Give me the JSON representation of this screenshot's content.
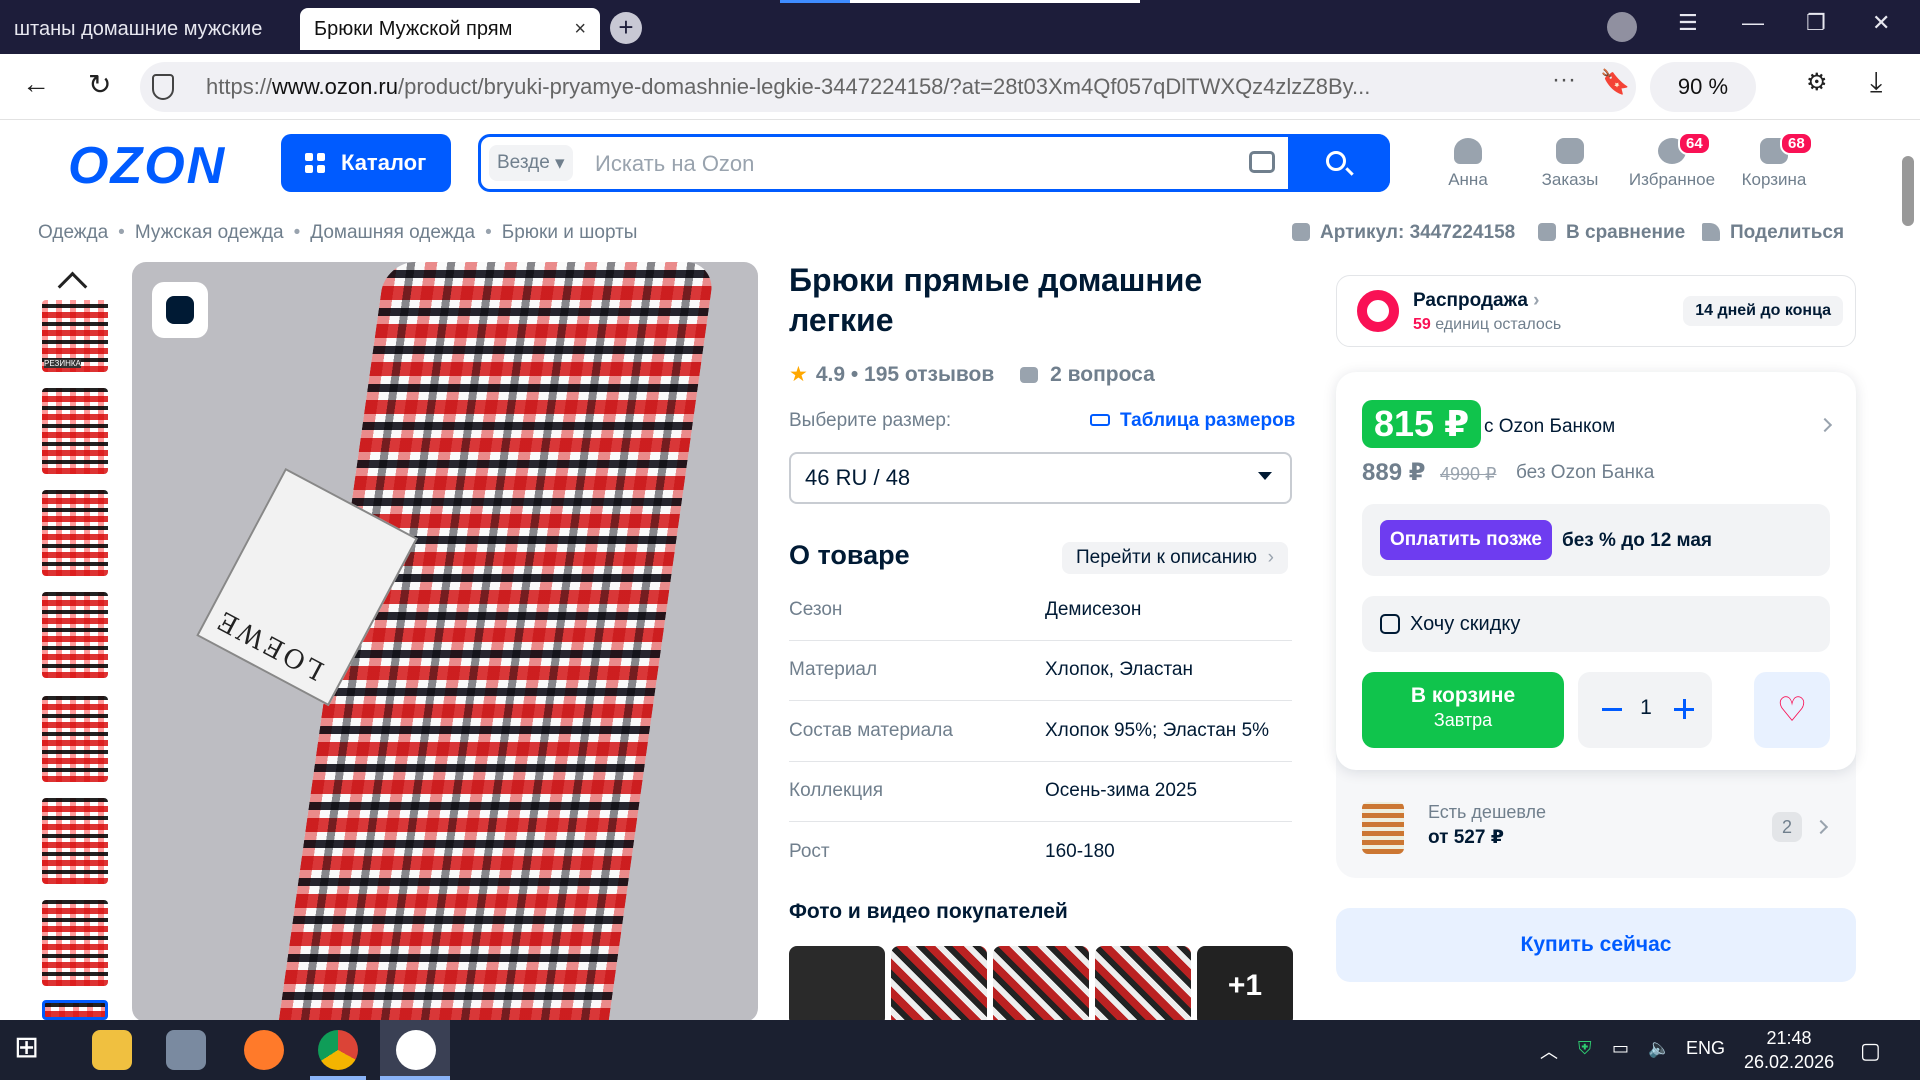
{
  "browser": {
    "tabs": [
      {
        "title": "штаны домашние мужские"
      },
      {
        "title": "Брюки Мужской прям"
      }
    ],
    "close_glyph": "×",
    "newtab_glyph": "+",
    "url_prefix": "https://",
    "url_host": "www.ozon.ru",
    "url_path": "/product/bryuki-pryamye-domashnie-legkie-3447224158/?at=28t03Xm4Qf057qDlTWXQz4zlzZ8By...",
    "zoom": "90 %"
  },
  "header": {
    "logo": "OZON",
    "catalog_label": "Каталог",
    "search_scope": "Везде",
    "search_placeholder": "Искать на Ozon",
    "icons": [
      {
        "label": "Анна",
        "badge": ""
      },
      {
        "label": "Заказы",
        "badge": ""
      },
      {
        "label": "Избранное",
        "badge": "64"
      },
      {
        "label": "Корзина",
        "badge": "68"
      }
    ]
  },
  "breadcrumbs": [
    "Одежда",
    "Мужская одежда",
    "Домашняя одежда",
    "Брюки и шорты"
  ],
  "meta": {
    "article": "Артикул: 3447224158",
    "compare": "В сравнение",
    "share": "Поделиться"
  },
  "gallery": {
    "thumb_caption": "РЕЗИНКА",
    "book_text": "LOEWE"
  },
  "product": {
    "title": "Брюки прямые домашние легкие",
    "rating": "4.9 • 195 отзывов",
    "questions": "2 вопроса",
    "size_label": "Выберите размер:",
    "size_table": "Таблица размеров",
    "size_selected": "46 RU / 48",
    "about_title": "О товаре",
    "to_description": "Перейти к описанию",
    "specs": [
      {
        "k": "Сезон",
        "v": "Демисезон"
      },
      {
        "k": "Материал",
        "v": "Хлопок, Эластан"
      },
      {
        "k": "Состав материала",
        "v": "Хлопок 95%; Эластан 5%"
      },
      {
        "k": "Коллекция",
        "v": "Осень-зима 2025"
      },
      {
        "k": "Рост",
        "v": "160-180"
      }
    ],
    "photos_title": "Фото и видео покупателей",
    "photos_more": "+1"
  },
  "offer": {
    "sale_title": "Распродажа",
    "sale_count": "59",
    "sale_sub": "единиц осталось",
    "sale_days": "14 дней до конца",
    "price_bank": "815 ₽",
    "with_bank": "с Ozon Банком",
    "price_regular": "889 ₽",
    "price_old": "4990 ₽",
    "without_bank": "без Ozon Банка",
    "pay_later_btn": "Оплатить позже",
    "pay_later_text": "без % до 12 мая",
    "want_discount": "Хочу скидку",
    "in_cart": "В корзине",
    "delivery": "Завтра",
    "quantity": "1",
    "cheaper_label": "Есть дешевле",
    "cheaper_price": "от 527 ₽",
    "cheaper_count": "2",
    "buy_now": "Купить сейчас"
  },
  "taskbar": {
    "lang": "ENG",
    "time": "21:48",
    "date": "26.02.2026"
  },
  "colors": {
    "brand": "#005bff",
    "green": "#10c44c",
    "pink": "#f91155",
    "purple": "#6e3cf0"
  }
}
